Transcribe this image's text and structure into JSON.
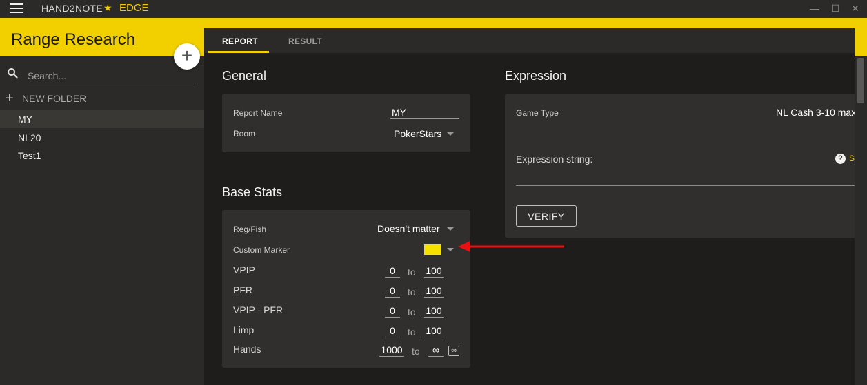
{
  "titlebar": {
    "app_name": "HAND2NOTE",
    "edition": "EDGE",
    "minimize": "—",
    "maximize": "☐",
    "close": "✕"
  },
  "header": {
    "title": "Range Research"
  },
  "sidebar": {
    "search_placeholder": "Search...",
    "new_folder": "NEW FOLDER",
    "items": [
      {
        "label": "MY",
        "active": true
      },
      {
        "label": "NL20",
        "active": false
      },
      {
        "label": "Test1",
        "active": false
      }
    ]
  },
  "tabs": [
    {
      "label": "REPORT",
      "active": true
    },
    {
      "label": "RESULT",
      "active": false
    }
  ],
  "general": {
    "title": "General",
    "report_name_label": "Report Name",
    "report_name_value": "MY",
    "room_label": "Room",
    "room_value": "PokerStars"
  },
  "base_stats": {
    "title": "Base Stats",
    "reg_fish_label": "Reg/Fish",
    "reg_fish_value": "Doesn't matter",
    "custom_marker_label": "Custom Marker",
    "custom_marker_color": "#f5e000",
    "to": "to",
    "rows": [
      {
        "label": "VPIP",
        "min": "0",
        "max": "100"
      },
      {
        "label": "PFR",
        "min": "0",
        "max": "100"
      },
      {
        "label": "VPIP - PFR",
        "min": "0",
        "max": "100"
      },
      {
        "label": "Limp",
        "min": "0",
        "max": "100"
      },
      {
        "label": "Hands",
        "min": "1000",
        "max": "∞"
      }
    ],
    "infinity_toggle": "∞"
  },
  "expression": {
    "title": "Expression",
    "game_type_label": "Game Type",
    "game_type_value": "NL Cash 3-10 max",
    "expression_label": "Expression string:",
    "help_link": "S",
    "verify_label": "VERIFY"
  },
  "colors": {
    "accent": "#f2d000",
    "background": "#1f1d1c",
    "panel": "#312f2d",
    "annotation_arrow": "#e81010"
  }
}
